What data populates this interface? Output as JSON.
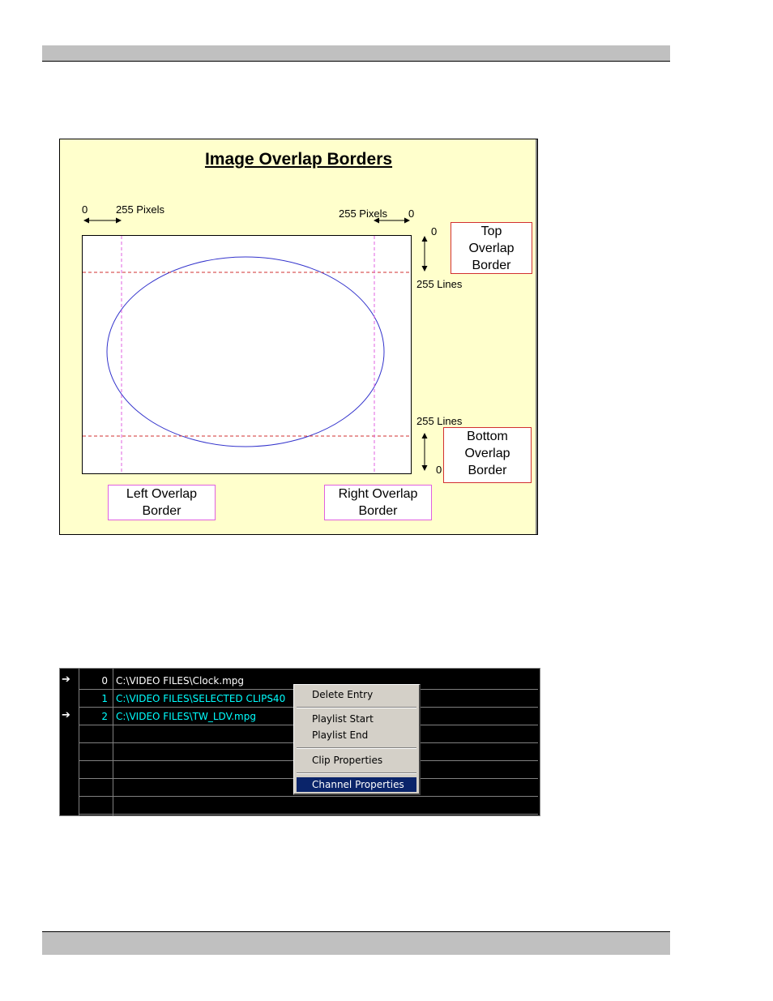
{
  "figure": {
    "title": "Image Overlap Borders",
    "left_pixels": {
      "zero": "0",
      "value": "255 Pixels"
    },
    "right_pixels": {
      "value": "255 Pixels",
      "zero": "0"
    },
    "top_lines": {
      "zero": "0",
      "value": "255 Lines"
    },
    "bottom_lines": {
      "value": "255 Lines",
      "zero": "0"
    },
    "boxes": {
      "top": [
        "Top",
        "Overlap",
        "Border"
      ],
      "bottom": [
        "Bottom",
        "Overlap",
        "Border"
      ],
      "left": [
        "Left Overlap",
        "Border"
      ],
      "right": [
        "Right Overlap",
        "Border"
      ]
    },
    "colors": {
      "background": "#ffffcc",
      "ellipse": "#3333cc",
      "horizontal_dash": "#d23030",
      "vertical_dash": "#e060e0"
    }
  },
  "playlist": {
    "rows": [
      {
        "marker": "➔",
        "index": "0",
        "path": "C:\\VIDEO FILES\\Clock.mpg",
        "color": "white"
      },
      {
        "marker": "",
        "index": "1",
        "path": "C:\\VIDEO FILES\\SELECTED CLIPS40",
        "color": "cyan"
      },
      {
        "marker": "➔",
        "index": "2",
        "path": "C:\\VIDEO FILES\\TW_LDV.mpg",
        "color": "cyan"
      },
      {
        "marker": "",
        "index": "",
        "path": "",
        "color": "white"
      },
      {
        "marker": "",
        "index": "",
        "path": "",
        "color": "white"
      },
      {
        "marker": "",
        "index": "",
        "path": "",
        "color": "white"
      },
      {
        "marker": "",
        "index": "",
        "path": "",
        "color": "white"
      },
      {
        "marker": "",
        "index": "",
        "path": "",
        "color": "white"
      }
    ]
  },
  "context_menu": {
    "delete_entry": "Delete Entry",
    "playlist_start": "Playlist Start",
    "playlist_end": "Playlist End",
    "clip_properties": "Clip Properties",
    "channel_properties": "Channel Properties",
    "selected": "Channel Properties"
  }
}
